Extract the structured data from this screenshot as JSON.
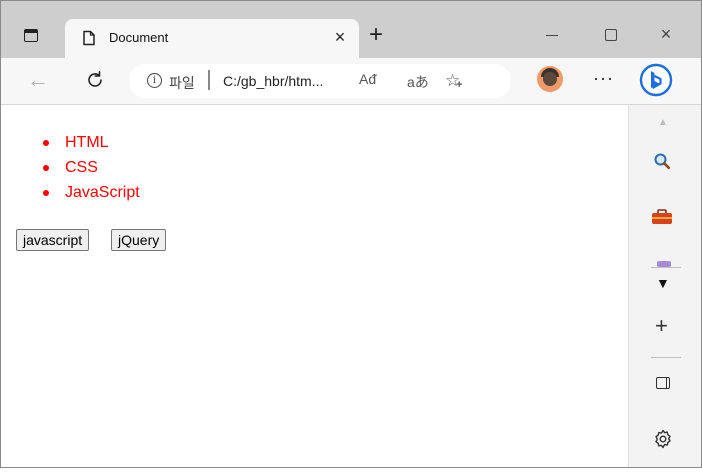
{
  "tab": {
    "title": "Document",
    "close_glyph": "×"
  },
  "window_controls": {
    "new_tab_glyph": "+",
    "close_glyph": "×"
  },
  "toolbar": {
    "back_glyph": "←",
    "address": {
      "site_label": "파일",
      "url": "C:/gb_hbr/htm...",
      "read_aloud_label": "Aᵭ",
      "translate_label": "aあ"
    },
    "more_glyph": "···"
  },
  "page": {
    "list_items": [
      "HTML",
      "CSS",
      "JavaScript"
    ],
    "list_color": "#ff0000",
    "buttons": {
      "javascript": "javascript",
      "jquery": "jQuery"
    }
  },
  "sidebar": {
    "icons": [
      "search-icon",
      "toolbox-icon",
      "chevron-down-icon",
      "plus-icon",
      "split-panel-icon",
      "gear-icon"
    ]
  }
}
